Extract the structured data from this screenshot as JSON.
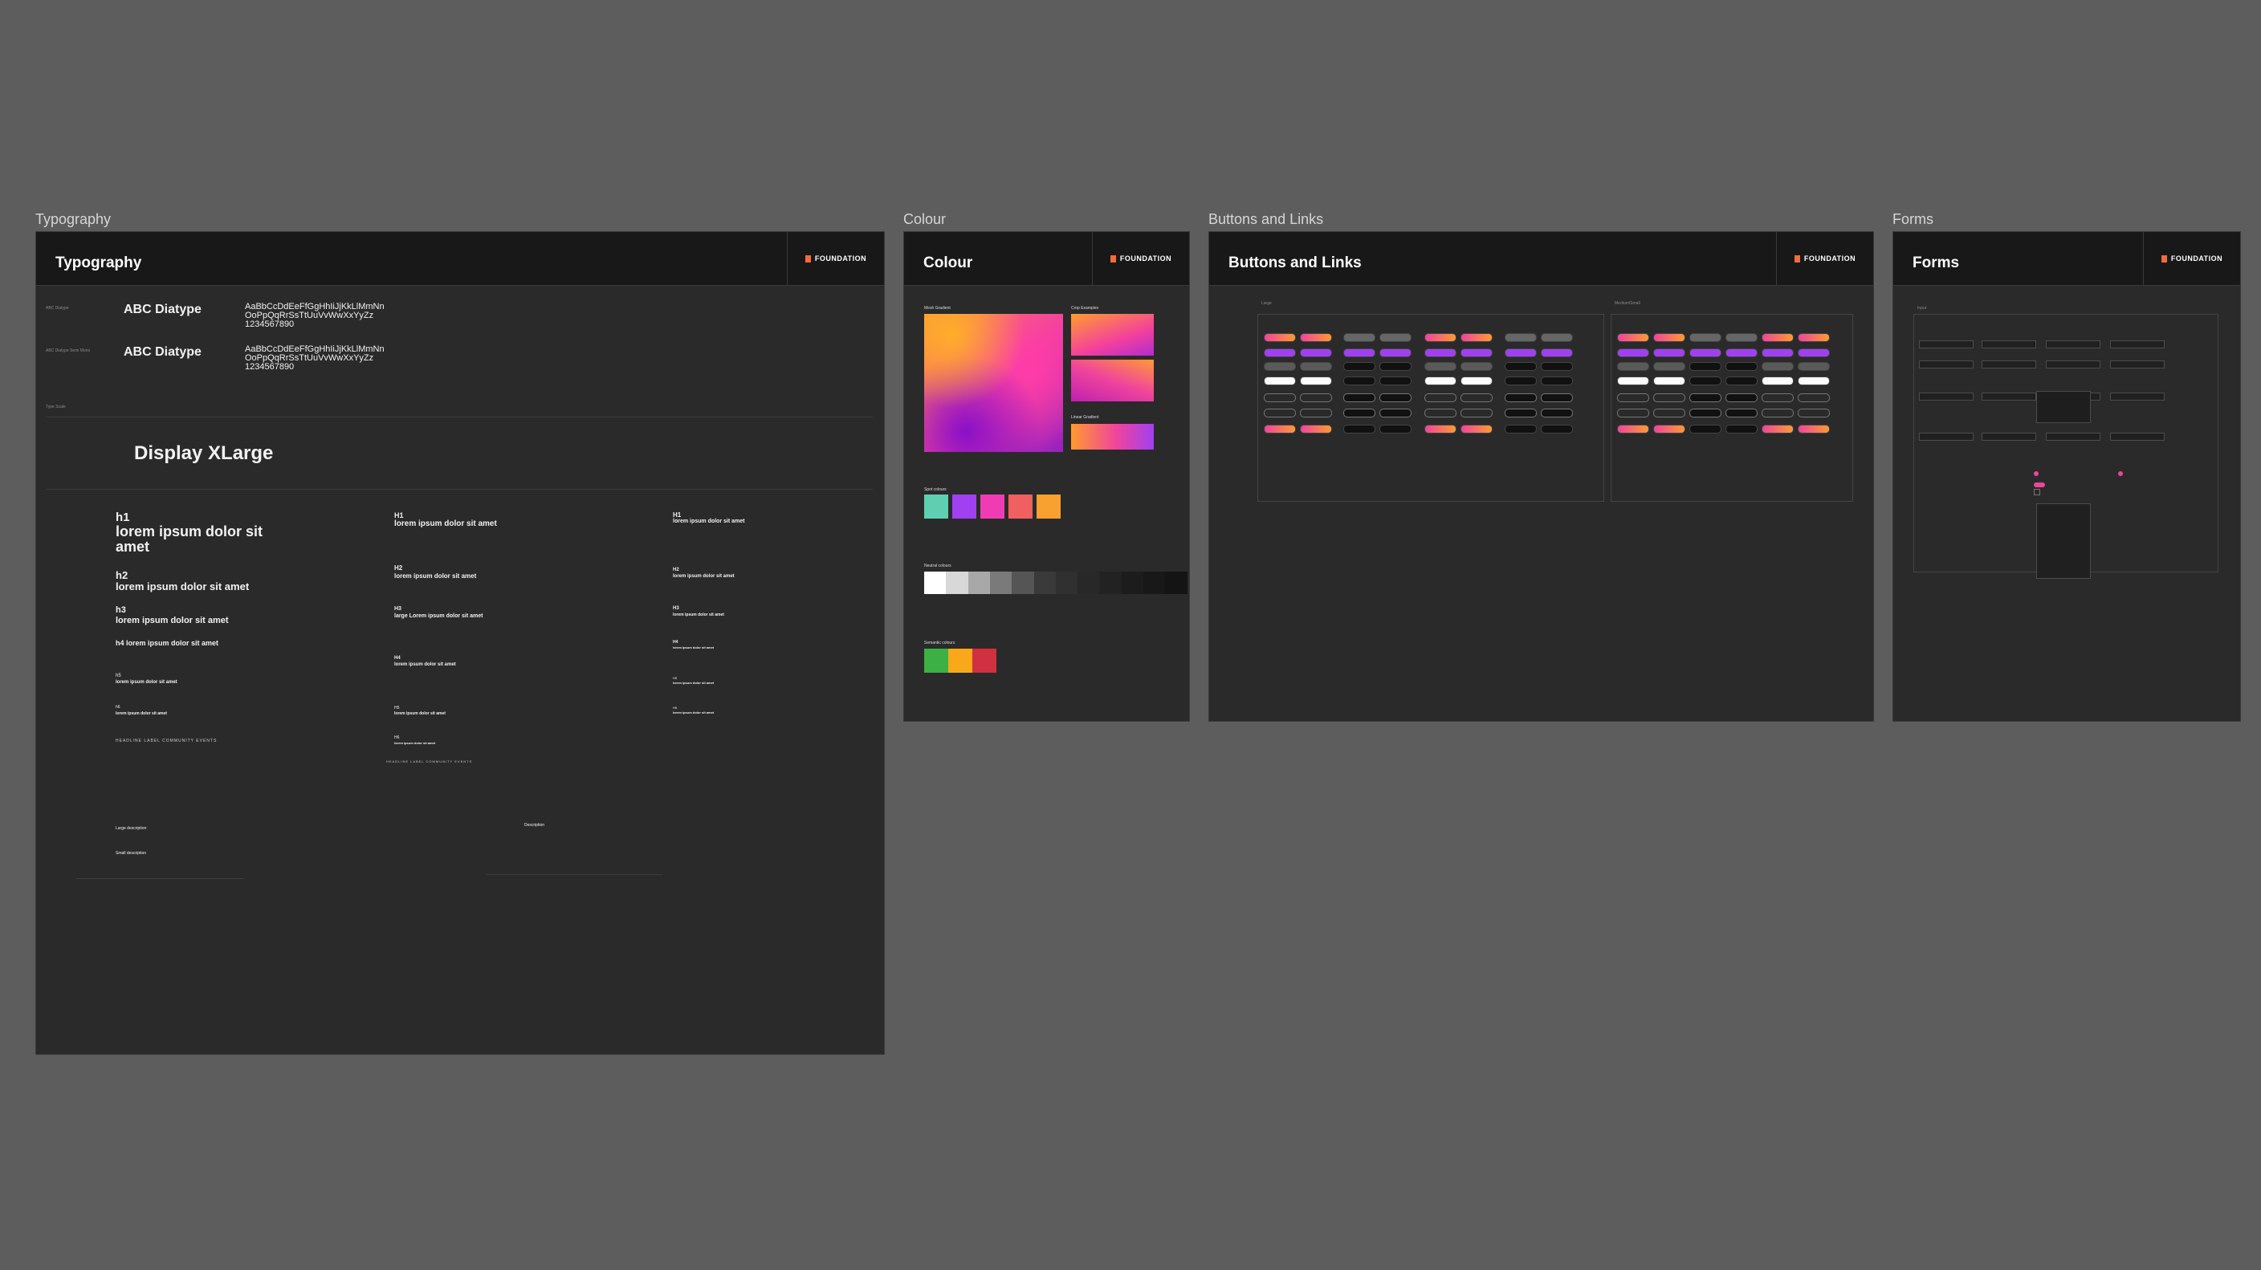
{
  "brand": {
    "name": "FOUNDATION",
    "accent": "#f26b3a"
  },
  "frames": {
    "typography": {
      "label": "Typography",
      "title": "Typography",
      "fonts": [
        {
          "label": "ABC Diatype",
          "name": "ABC Diatype",
          "sample_line1": "AaBbCcDdEeFfGgHhIiJjKkLlMmNn",
          "sample_line2": "OoPpQqRrSsTtUuVvWwXxYyZz",
          "sample_line3": "1234567890"
        },
        {
          "label": "ABC Diatype Semi Mono",
          "name": "ABC Diatype",
          "sample_line1": "AaBbCcDdEeFfGgHhIiJjKkLlMmNn",
          "sample_line2": "OoPpQqRrSsTtUuVvWwXxYyZz",
          "sample_line3": "1234567890"
        }
      ],
      "type_scale_label": "Type Scale",
      "display": "Display XLarge",
      "columns": [
        {
          "h1_tag": "h1",
          "h1": "lorem ipsum dolor sit amet",
          "h2_tag": "h2",
          "h2": "lorem ipsum dolor sit amet",
          "h3_tag": "h3",
          "h3": "lorem ipsum dolor sit amet",
          "h4": "h4  lorem ipsum dolor sit amet",
          "h5_tag": "h5",
          "h5": "lorem ipsum dolor sit amet",
          "h6_tag": "h6",
          "h6": "lorem ipsum dolor sit amet",
          "label": "HEADLINE LABEL COMMUNITY EVENTS"
        },
        {
          "h1_tag": "H1",
          "h1": "lorem ipsum dolor sit amet",
          "h2_tag": "H2",
          "h2": "lorem ipsum dolor sit amet",
          "h3_tag": "H3",
          "h3": "large Lorem ipsum dolor sit amet",
          "h4_tag": "H4",
          "h4": "lorem ipsum dolor sit amet",
          "h5_tag": "H5",
          "h5": "lorem ipsum dolor sit amet",
          "h6_tag": "H6",
          "h6": "lorem ipsum dolor sit amet",
          "label": "HEADLINE LABEL COMMUNITY EVENTS"
        },
        {
          "h1_tag": "H1",
          "h1": "lorem ipsum dolor sit amet",
          "h2_tag": "H2",
          "h2": "lorem ipsum dolor sit amet",
          "h3_tag": "H3",
          "h3": "lorem ipsum dolor sit amet",
          "h4_tag": "H4",
          "h4": "lorem ipsum dolor sit amet",
          "h5_tag": "H5",
          "h5": "lorem ipsum dolor sit amet",
          "h6_tag": "H6",
          "h6": "lorem ipsum dolor sit amet"
        }
      ],
      "body_left": {
        "large": "Large description",
        "small": "Small description"
      },
      "body_right": {
        "label": "Description"
      }
    },
    "colour": {
      "label": "Colour",
      "title": "Colour",
      "mesh_label": "Mesh Gradient",
      "crop_label": "Crop Examples",
      "linear_label": "Linear Gradient",
      "spot_label": "Spot colours",
      "spot_colors": [
        "#5fcfb2",
        "#a040f0",
        "#f03cb4",
        "#f06060",
        "#f8a030"
      ],
      "neutral_label": "Neutral colours",
      "neutral_colors": [
        "#ffffff",
        "#d8d8d8",
        "#a8a8a8",
        "#7a7a7a",
        "#555555",
        "#3a3a3a",
        "#303030",
        "#282828",
        "#222222",
        "#1c1c1c",
        "#181818",
        "#141414"
      ],
      "semantic_label": "Semantic colours",
      "semantic_colors": [
        "#3cb044",
        "#f8a818",
        "#d03040"
      ]
    },
    "buttons": {
      "label": "Buttons and Links",
      "title": "Buttons and Links",
      "group_large": "Large",
      "group_medium": "Medium/Small"
    },
    "forms": {
      "label": "Forms",
      "title": "Forms",
      "input_label": "Input"
    }
  }
}
